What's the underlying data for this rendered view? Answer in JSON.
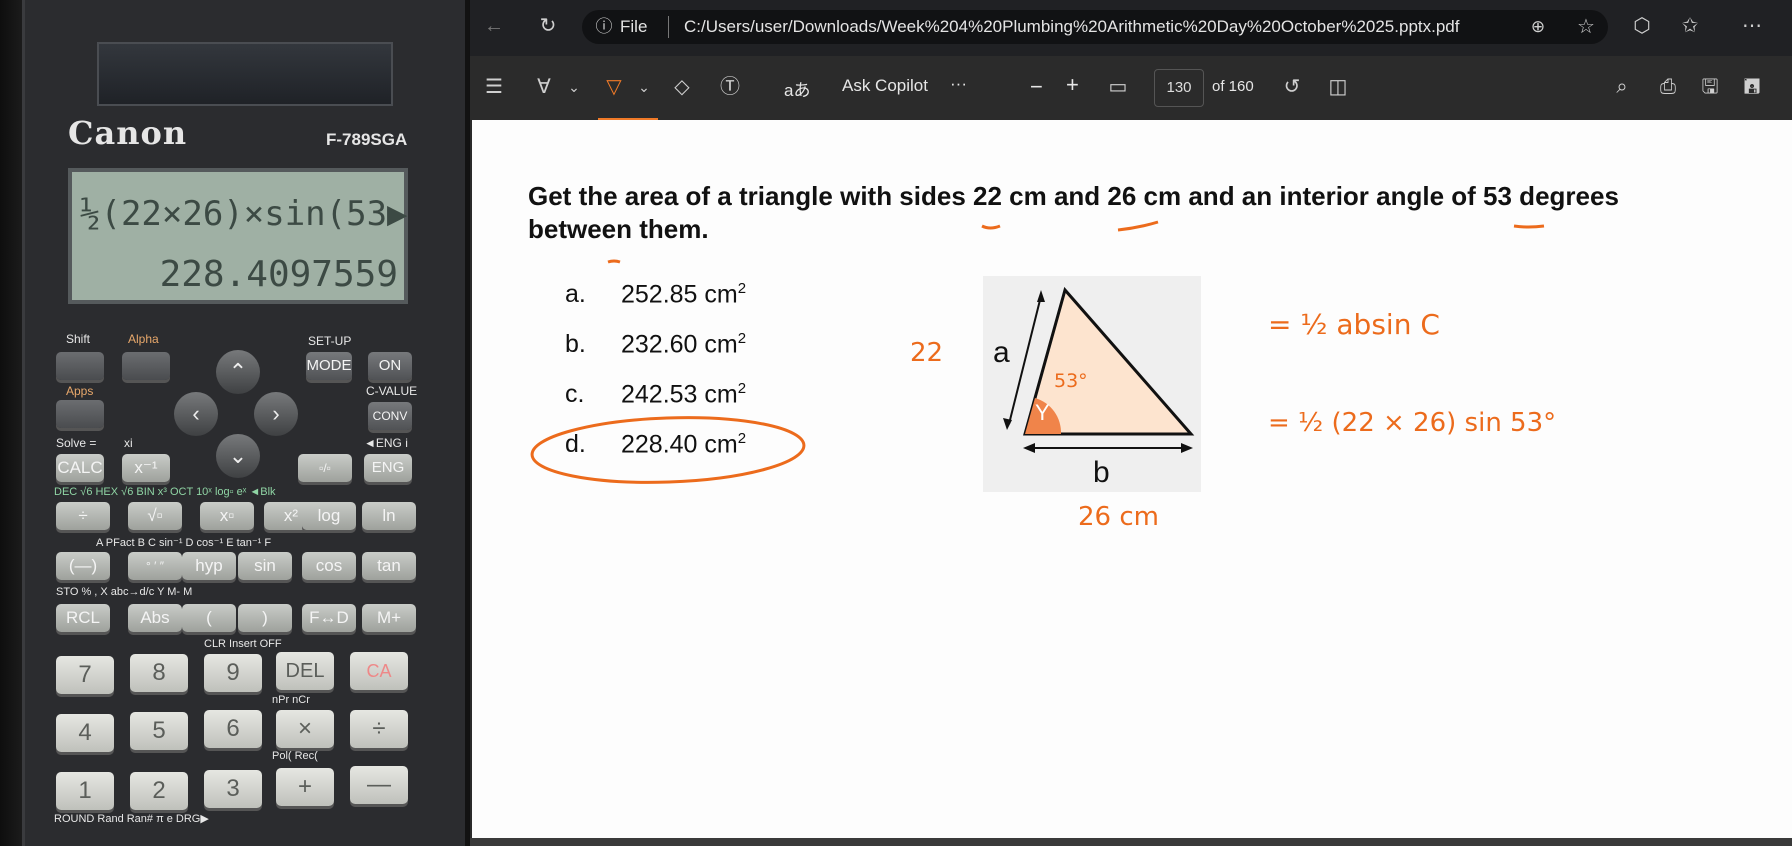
{
  "calculator": {
    "brand": "Canon",
    "model": "F-789SGA",
    "display": {
      "expression": "½(22×26)×sin(53▶",
      "result": "228.4097559"
    },
    "top_labels": {
      "shift": "Shift",
      "alpha": "Alpha",
      "setup": "SET-UP",
      "mode": "MODE",
      "on": "ON",
      "apps": "Apps",
      "cvalue": "C-VALUE",
      "conv": "CONV",
      "solve": "Solve =",
      "xi": "xi",
      "eng_l": "◄ENG i"
    },
    "keys_row1": [
      "CALC",
      "x⁻¹",
      "ENG"
    ],
    "keys_row2": [
      "÷",
      "√▫",
      "x▫",
      "x²",
      "log",
      "ln"
    ],
    "keys_row3": [
      "(—)",
      "° ′ ″",
      "hyp",
      "sin",
      "cos",
      "tan"
    ],
    "keys_row4": [
      "RCL",
      "Abs",
      "(",
      ")",
      "F↔D",
      "M+"
    ],
    "num_row1": [
      "7",
      "8",
      "9",
      "DEL",
      "CA"
    ],
    "num_row2": [
      "4",
      "5",
      "6",
      "×",
      "÷"
    ],
    "num_row3": [
      "1",
      "2",
      "3",
      "+",
      "—"
    ],
    "sub_labels": {
      "row2": "DEC  √6 HEX  √6 BIN  x³ OCT  10ˣ log▫  eˣ ◄Blk",
      "row3": "A  PFact  B      C  sin⁻¹  D  cos⁻¹  E  tan⁻¹  F",
      "row4": "STO          %        ,     X  abc→d/c  Y   M-    M",
      "num1": "CLR   Insert   OFF",
      "num2": "nPr   nCr",
      "num3": "Pol(   Rec(",
      "bottom": "ROUND   Rand  Ran#   π   e   DRG▶"
    }
  },
  "browser": {
    "address": {
      "file_label": "File",
      "url": "C:/Users/user/Downloads/Week%204%20Plumbing%20Arithmetic%20Day%20October%2025.pptx.pdf"
    },
    "toolbar": {
      "read_aloud_glyph": "aあ",
      "ask_copilot": "Ask Copilot",
      "more": "···",
      "zoom_out": "−",
      "zoom_in": "+",
      "page_current": "130",
      "page_total": "of 160"
    }
  },
  "document": {
    "question": "Get the area of a triangle with sides 22 cm and 26 cm and an interior angle of 53 degrees between them.",
    "options": [
      {
        "letter": "a.",
        "value": "252.85 cm",
        "sup": "2"
      },
      {
        "letter": "b.",
        "value": "232.60 cm",
        "sup": "2"
      },
      {
        "letter": "c.",
        "value": "242.53 cm",
        "sup": "2"
      },
      {
        "letter": "d.",
        "value": "228.40 cm",
        "sup": "2"
      }
    ],
    "diagram": {
      "side_a": "a",
      "side_b": "b",
      "angle": "Y"
    },
    "annotations": {
      "side_a_value": "22",
      "side_b_value": "26 cm",
      "angle_value": "53°",
      "formula_1": "= ½ absin C",
      "formula_2": "= ½ (22 × 26) sin 53°"
    }
  }
}
